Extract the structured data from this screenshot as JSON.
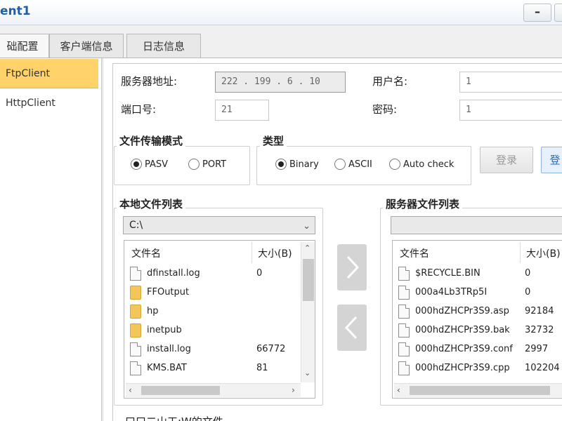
{
  "window": {
    "title": "ent1",
    "minimize_label": "–"
  },
  "tabs": [
    {
      "label": "础配置",
      "active": true
    },
    {
      "label": "客户端信息",
      "active": false
    },
    {
      "label": "日志信息",
      "active": false
    }
  ],
  "sidebar": {
    "items": [
      {
        "label": "FtpClient",
        "active": true
      },
      {
        "label": "HttpClient",
        "active": false
      }
    ]
  },
  "connection": {
    "server_label": "服务器地址:",
    "server_ip": "222 . 199 .  6  . 10",
    "port_label": "端口号:",
    "port_value": "21",
    "user_label": "用户名:",
    "user_value": "1",
    "password_label": "密码:",
    "password_value": "1"
  },
  "transfer_mode": {
    "title": "文件传输模式",
    "options": [
      {
        "label": "PASV",
        "selected": true
      },
      {
        "label": "PORT",
        "selected": false
      }
    ]
  },
  "type_group": {
    "title": "类型",
    "options": [
      {
        "label": "Binary",
        "selected": true
      },
      {
        "label": "ASCII",
        "selected": false
      },
      {
        "label": "Auto check",
        "selected": false
      }
    ]
  },
  "buttons": {
    "login": "登录",
    "second": "登"
  },
  "local_files": {
    "title": "本地文件列表",
    "path": "C:\\",
    "col_name": "文件名",
    "col_size": "大小(B)",
    "rows": [
      {
        "name": "dfinstall.log",
        "size": "0",
        "icon": "file-icon"
      },
      {
        "name": "FFOutput",
        "size": "",
        "icon": "folder-icon"
      },
      {
        "name": "hp",
        "size": "",
        "icon": "folder-icon"
      },
      {
        "name": "inetpub",
        "size": "",
        "icon": "folder-icon"
      },
      {
        "name": "install.log",
        "size": "66772",
        "icon": "file-icon"
      },
      {
        "name": "KMS.BAT",
        "size": "81",
        "icon": "file-icon"
      }
    ]
  },
  "server_files": {
    "title": "服务器文件列表",
    "path": "",
    "col_name": "文件名",
    "col_size": "大小(B)",
    "rows": [
      {
        "name": "$RECYCLE.BIN",
        "size": "0",
        "icon": "file-icon"
      },
      {
        "name": "000a4Lb3TRp5I",
        "size": "0",
        "icon": "file-icon"
      },
      {
        "name": "000hdZHCPr3S9.asp",
        "size": "92184",
        "icon": "file-icon"
      },
      {
        "name": "000hdZHCPr3S9.bak",
        "size": "32732",
        "icon": "file-icon"
      },
      {
        "name": "000hdZHCPr3S9.conf",
        "size": "2997",
        "icon": "file-icon"
      },
      {
        "name": "000hdZHCPr3S9.cpp",
        "size": "102204",
        "icon": "file-icon"
      }
    ]
  },
  "footer": {
    "note": "口口二山工:W的文件"
  },
  "colors": {
    "accent": "#ffd26a",
    "title": "#1f5fa8"
  }
}
